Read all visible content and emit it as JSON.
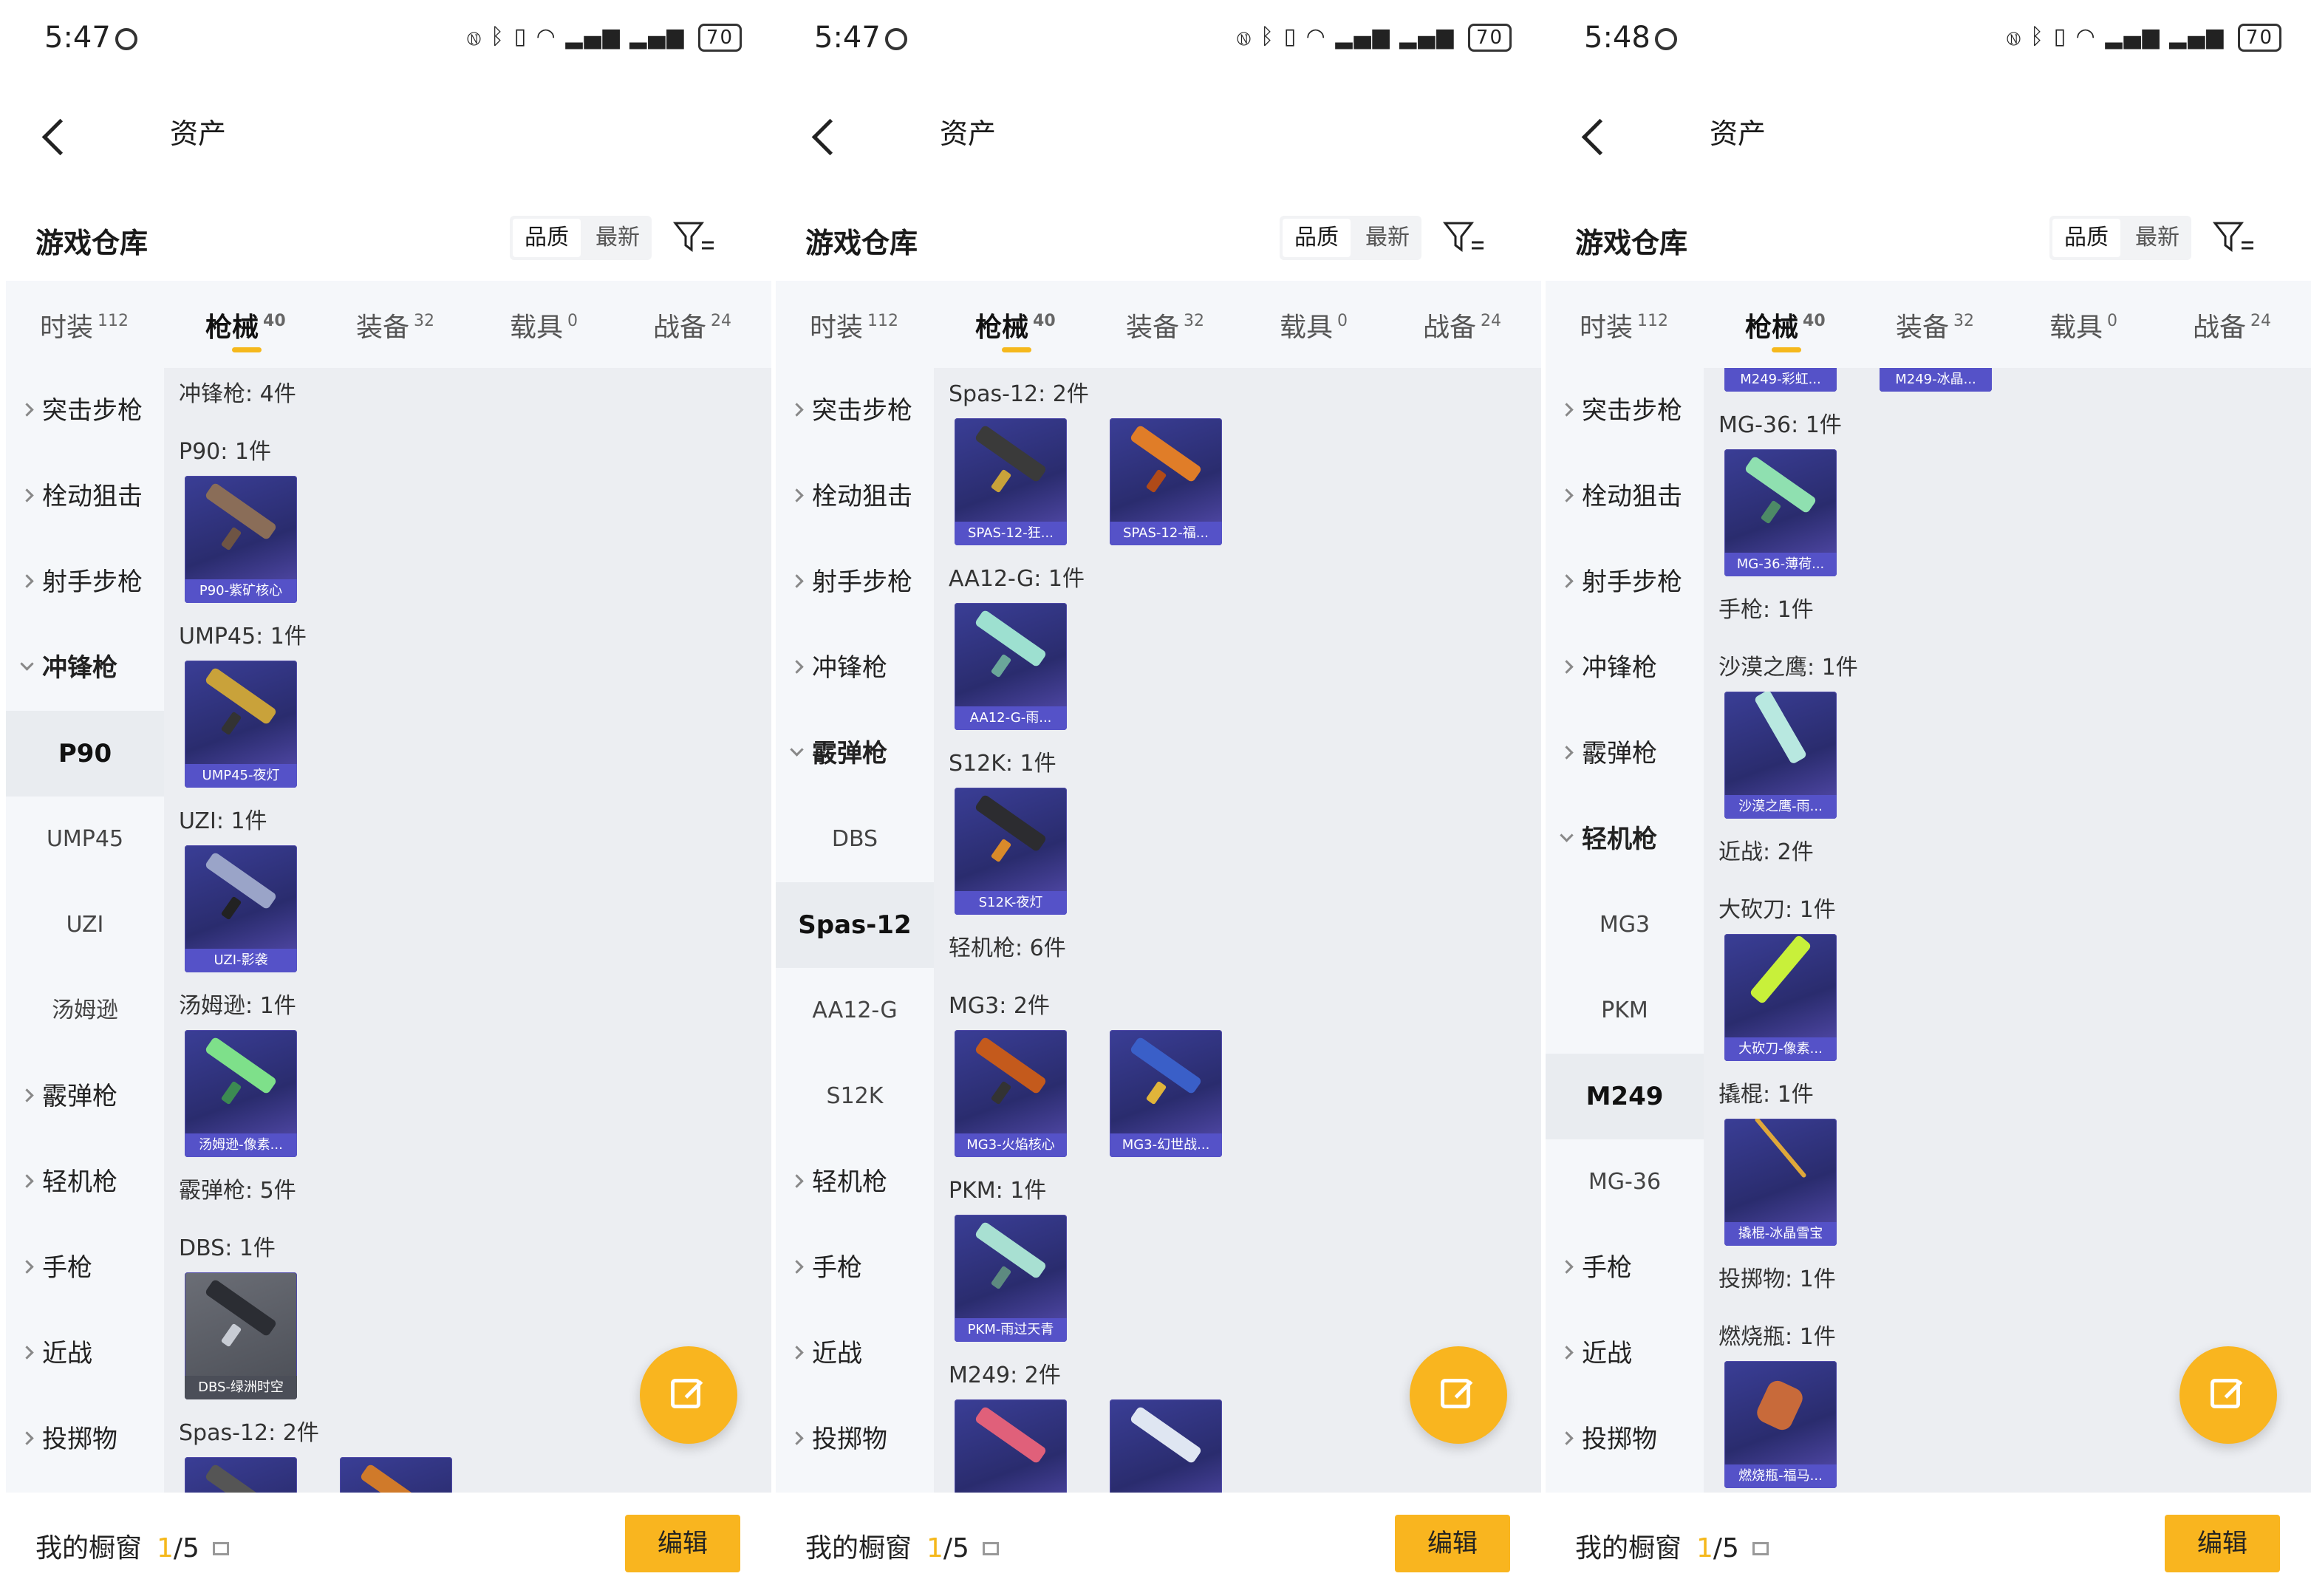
{
  "panels": [
    {
      "time": "5:47",
      "battery": "70",
      "header_title": "资产",
      "section_title": "游戏仓库",
      "sort_options": [
        "品质",
        "最新"
      ],
      "tabs": [
        {
          "label": "时装",
          "count": "112"
        },
        {
          "label": "枪械",
          "count": "40"
        },
        {
          "label": "装备",
          "count": "32"
        },
        {
          "label": "载具",
          "count": "0"
        },
        {
          "label": "战备",
          "count": "24"
        }
      ],
      "side_items": [
        "突击步枪",
        "栓动狙击",
        "射手步枪",
        "冲锋枪",
        "P90",
        "UMP45",
        "UZI",
        "汤姆逊",
        "霰弹枪",
        "轻机枪",
        "手枪",
        "近战",
        "投掷物"
      ],
      "content_labels": [
        "冲锋枪: 4件",
        "P90: 1件",
        "UMP45: 1件",
        "UZI: 1件",
        "汤姆逊: 1件",
        "霰弹枪: 5件",
        "DBS: 1件",
        "Spas-12: 2件"
      ],
      "cards": [
        "P90-紫矿核心",
        "UMP45-夜灯",
        "UZI-影袭",
        "汤姆逊-像素...",
        "DBS-绿洲时空",
        "",
        ""
      ],
      "shop_label": "我的橱窗",
      "shop_num": "1",
      "shop_total": "/5",
      "edit_label": "编辑"
    },
    {
      "time": "5:47",
      "battery": "70",
      "header_title": "资产",
      "section_title": "游戏仓库",
      "sort_options": [
        "品质",
        "最新"
      ],
      "tabs": [
        {
          "label": "时装",
          "count": "112"
        },
        {
          "label": "枪械",
          "count": "40"
        },
        {
          "label": "装备",
          "count": "32"
        },
        {
          "label": "载具",
          "count": "0"
        },
        {
          "label": "战备",
          "count": "24"
        }
      ],
      "side_items": [
        "突击步枪",
        "栓动狙击",
        "射手步枪",
        "冲锋枪",
        "霰弹枪",
        "DBS",
        "Spas-12",
        "AA12-G",
        "S12K",
        "轻机枪",
        "手枪",
        "近战",
        "投掷物"
      ],
      "content_labels": [
        "Spas-12: 2件",
        "AA12-G: 1件",
        "S12K: 1件",
        "轻机枪: 6件",
        "MG3: 2件",
        "PKM: 1件",
        "M249: 2件"
      ],
      "cards": [
        "SPAS-12-狂...",
        "SPAS-12-福...",
        "AA12-G-雨...",
        "S12K-夜灯",
        "MG3-火焰核心",
        "MG3-幻世战...",
        "PKM-雨过天青",
        "",
        ""
      ],
      "shop_label": "我的橱窗",
      "shop_num": "1",
      "shop_total": "/5",
      "edit_label": "编辑"
    },
    {
      "time": "5:48",
      "battery": "70",
      "header_title": "资产",
      "section_title": "游戏仓库",
      "sort_options": [
        "品质",
        "最新"
      ],
      "tabs": [
        {
          "label": "时装",
          "count": "112"
        },
        {
          "label": "枪械",
          "count": "40"
        },
        {
          "label": "装备",
          "count": "32"
        },
        {
          "label": "载具",
          "count": "0"
        },
        {
          "label": "战备",
          "count": "24"
        }
      ],
      "side_items": [
        "突击步枪",
        "栓动狙击",
        "射手步枪",
        "冲锋枪",
        "霰弹枪",
        "轻机枪",
        "MG3",
        "PKM",
        "M249",
        "MG-36",
        "手枪",
        "近战",
        "投掷物"
      ],
      "content_labels": [
        "MG-36: 1件",
        "手枪: 1件",
        "沙漠之鹰: 1件",
        "近战: 2件",
        "大砍刀: 1件",
        "撬棍: 1件",
        "投掷物: 1件",
        "燃烧瓶: 1件"
      ],
      "cards": [
        "M249-彩虹...",
        "M249-冰晶...",
        "MG-36-薄荷...",
        "沙漠之鹰-雨...",
        "大砍刀-像素...",
        "撬棍-冰晶雪宝",
        "燃烧瓶-福马..."
      ],
      "shop_label": "我的橱窗",
      "shop_num": "1",
      "shop_total": "/5",
      "edit_label": "编辑"
    }
  ]
}
